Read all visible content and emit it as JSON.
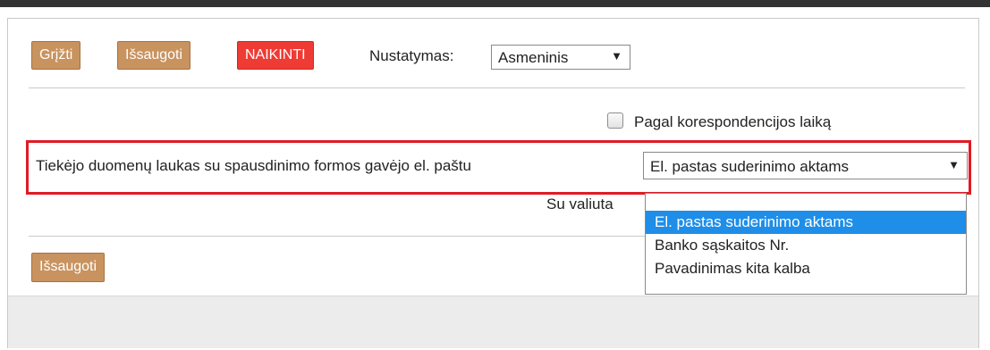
{
  "toolbar": {
    "back_label": "Grįžti",
    "save_label": "Išsaugoti",
    "delete_label": "NAIKINTI",
    "setting_label": "Nustatymas:",
    "setting_value": "Asmeninis"
  },
  "form": {
    "checkbox_label": "Pagal korespondencijos laiką",
    "checkbox_checked": false,
    "field_label": "Tiekėjo duomenų laukas su spausdinimo formos gavėjo el. paštu",
    "field_value": "El. pastas suderinimo aktams",
    "currency_label": "Su valiuta",
    "dropdown_options": [
      "",
      "El. pastas suderinimo aktams",
      "Banko sąskaitos Nr.",
      "Pavadinimas kita kalba"
    ],
    "dropdown_selected_index": 1
  },
  "footer": {
    "save_label": "Išsaugoti"
  },
  "colors": {
    "brown_button": "#c8935f",
    "red_button": "#ee3b34",
    "highlight_border": "#e01b24",
    "selected_option": "#1e8ee8"
  },
  "icons": {
    "dropdown_arrow": "▼"
  }
}
